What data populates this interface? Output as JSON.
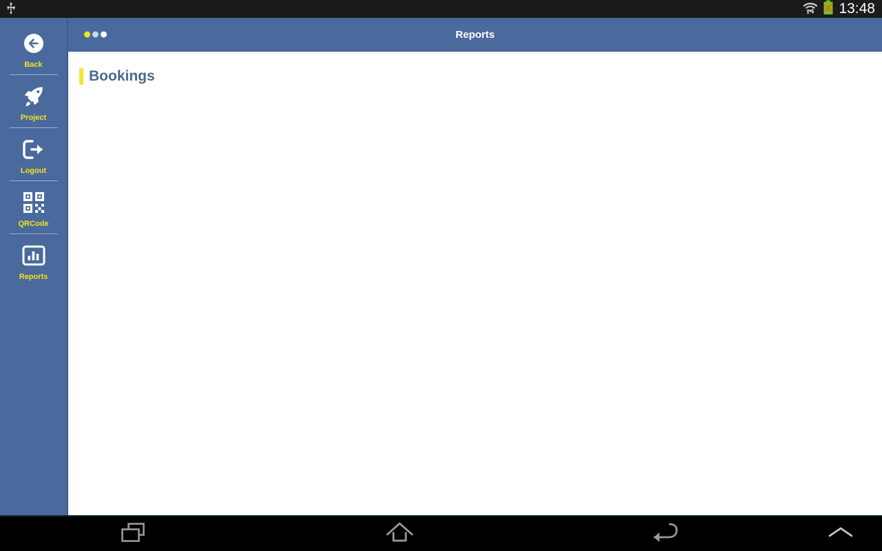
{
  "statusbar": {
    "usb_icon": "usb-icon",
    "wifi_icon": "wifi-transfer-icon",
    "battery_icon": "battery-error-icon",
    "time": "13:48"
  },
  "sidebar": {
    "items": [
      {
        "label": "Back",
        "icon": "back-arrow-circle-icon"
      },
      {
        "label": "Project",
        "icon": "rocket-icon"
      },
      {
        "label": "Logout",
        "icon": "logout-icon"
      },
      {
        "label": "QRCode",
        "icon": "qrcode-icon"
      },
      {
        "label": "Reports",
        "icon": "bar-chart-icon"
      }
    ]
  },
  "appbar": {
    "title": "Reports",
    "dots": [
      "#f2e419",
      "#c6d9f0",
      "#ffffff"
    ]
  },
  "main": {
    "section_title": "Bookings"
  },
  "navbar": {
    "recents_label": "recents-icon",
    "home_label": "home-icon",
    "back_label": "back-icon",
    "expand_label": "chevron-up-icon"
  },
  "colors": {
    "brand_blue": "#4a6a9d",
    "accent_yellow": "#f2e419",
    "heading_blue": "#4a6a8f",
    "content_bg": "#ffffff"
  }
}
